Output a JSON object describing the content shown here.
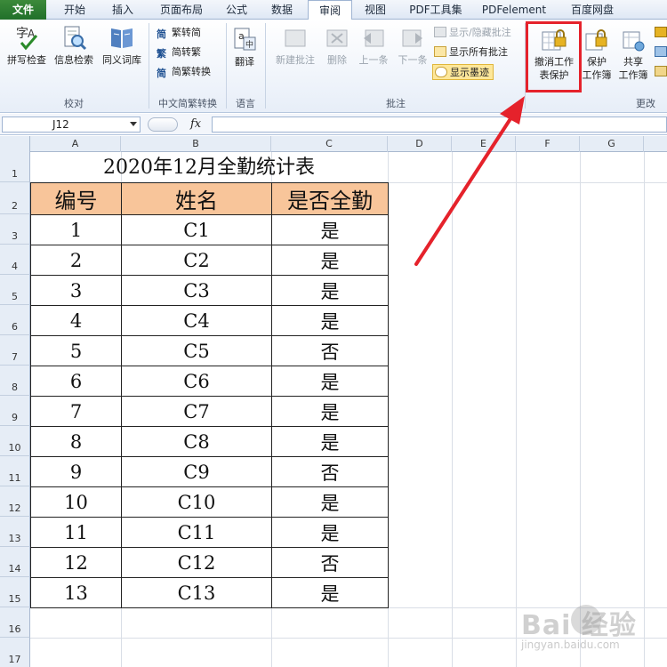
{
  "tabs": [
    "文件",
    "开始",
    "插入",
    "页面布局",
    "公式",
    "数据",
    "审阅",
    "视图",
    "PDF工具集",
    "PDFelement",
    "百度网盘"
  ],
  "active_tab": "审阅",
  "ribbon": {
    "proofing": {
      "label": "校对",
      "spell_check": "拼写检查",
      "research": "信息检索",
      "thesaurus": "同义词库"
    },
    "chinese_conversion": {
      "label": "中文简繁转换",
      "to_simplified": "繁转简",
      "to_traditional": "简转繁",
      "convert": "简繁转换"
    },
    "language": {
      "label": "语言",
      "translate": "翻译"
    },
    "comments": {
      "label": "批注",
      "new_comment": "新建批注",
      "delete": "删除",
      "previous": "上一条",
      "next": "下一条",
      "show_hide": "显示/隐藏批注",
      "show_all": "显示所有批注",
      "show_ink": "显示墨迹"
    },
    "changes": {
      "label": "更改",
      "unprotect_line1": "撤消工作",
      "unprotect_line2": "表保护",
      "protect_wb_line1": "保护",
      "protect_wb_line2": "工作簿",
      "share_line1": "共享",
      "share_line2": "工作簿"
    }
  },
  "formula_bar": {
    "name_box": "J12",
    "fx": "fx",
    "value": ""
  },
  "columns": [
    "A",
    "B",
    "C",
    "D",
    "E",
    "F",
    "G"
  ],
  "rows": [
    "1",
    "2",
    "3",
    "4",
    "5",
    "6",
    "7",
    "8",
    "9",
    "10",
    "11",
    "12",
    "13",
    "14",
    "15",
    "16",
    "17"
  ],
  "sheet": {
    "title": "2020年12月全勤统计表",
    "headers": [
      "编号",
      "姓名",
      "是否全勤"
    ],
    "records": [
      [
        "1",
        "C1",
        "是"
      ],
      [
        "2",
        "C2",
        "是"
      ],
      [
        "3",
        "C3",
        "是"
      ],
      [
        "4",
        "C4",
        "是"
      ],
      [
        "5",
        "C5",
        "否"
      ],
      [
        "6",
        "C6",
        "是"
      ],
      [
        "7",
        "C7",
        "是"
      ],
      [
        "8",
        "C8",
        "是"
      ],
      [
        "9",
        "C9",
        "否"
      ],
      [
        "10",
        "C10",
        "是"
      ],
      [
        "11",
        "C11",
        "是"
      ],
      [
        "12",
        "C12",
        "否"
      ],
      [
        "13",
        "C13",
        "是"
      ]
    ]
  },
  "watermark": {
    "text": "Bai 经验",
    "sub": "jingyan.baidu.com"
  },
  "colors": {
    "header_fill": "#f8c59a",
    "annotation": "#e5222b",
    "file_tab": "#2e7d32"
  }
}
